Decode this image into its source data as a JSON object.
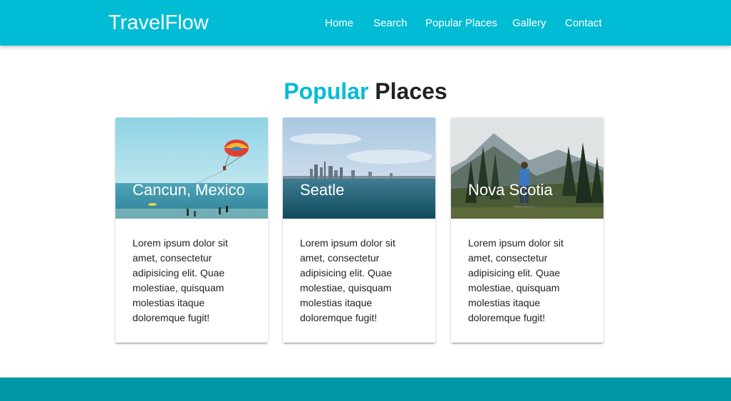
{
  "navbar": {
    "brand": "TravelFlow",
    "links": [
      {
        "label": "Home"
      },
      {
        "label": "Search"
      },
      {
        "label": "Popular Places"
      },
      {
        "label": "Gallery"
      },
      {
        "label": "Contact"
      }
    ],
    "color": "#00bcd4"
  },
  "section": {
    "title_accent": "Popular",
    "title_rest": "Places",
    "accent_color": "#00bcd4"
  },
  "cards": [
    {
      "title": "Cancun, Mexico",
      "image": "beach-parasail-photo",
      "text": "Lorem ipsum dolor sit amet, consectetur adipisicing elit. Quae molestiae, quisquam molestias itaque doloremque fugit!"
    },
    {
      "title": "Seatle",
      "image": "city-skyline-sea-photo",
      "text": "Lorem ipsum dolor sit amet, consectetur adipisicing elit. Quae molestiae, quisquam molestias itaque doloremque fugit!"
    },
    {
      "title": "Nova Scotia",
      "image": "mountain-forest-hiker-photo",
      "text": "Lorem ipsum dolor sit amet, consectetur adipisicing elit. Quae molestiae, quisquam molestias itaque doloremque fugit!"
    }
  ],
  "footer": {
    "color": "#0097a7"
  }
}
